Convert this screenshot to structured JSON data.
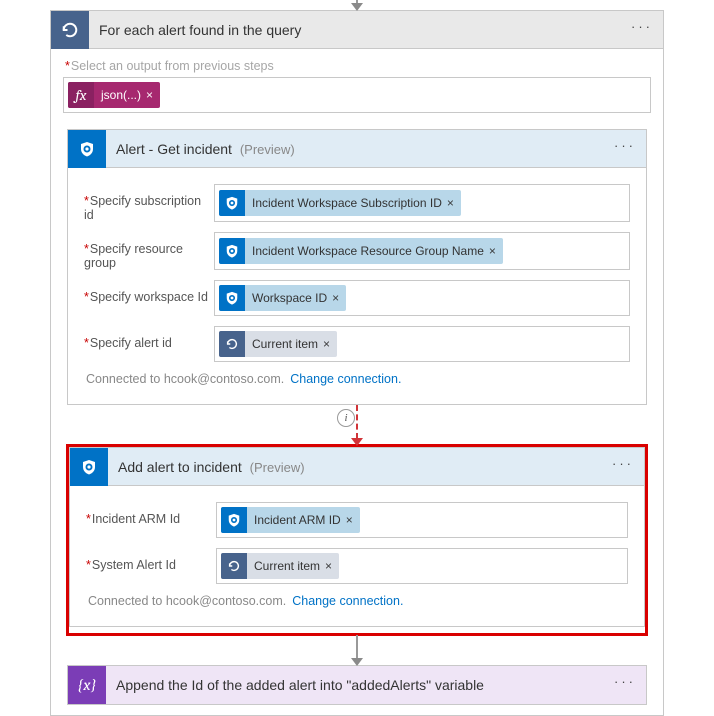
{
  "foreach": {
    "title": "For each alert found in the query",
    "outputLabel": "Select an output from previous steps",
    "jsonToken": "json(...)"
  },
  "getIncident": {
    "title": "Alert - Get incident",
    "preview": "(Preview)",
    "rows": {
      "sub": {
        "label": "Specify subscription id",
        "token": "Incident Workspace Subscription ID"
      },
      "rg": {
        "label": "Specify resource group",
        "token": "Incident Workspace Resource Group Name"
      },
      "ws": {
        "label": "Specify workspace Id",
        "token": "Workspace ID"
      },
      "al": {
        "label": "Specify alert id",
        "token": "Current item"
      }
    }
  },
  "addAlert": {
    "title": "Add alert to incident",
    "preview": "(Preview)",
    "rows": {
      "arm": {
        "label": "Incident ARM Id",
        "token": "Incident ARM ID"
      },
      "sys": {
        "label": "System Alert Id",
        "token": "Current item"
      }
    }
  },
  "connection": {
    "text": "Connected to hcook@contoso.com.",
    "change": "Change connection."
  },
  "appendVar": {
    "title": "Append the Id of the added alert into \"addedAlerts\" variable"
  },
  "close": "×"
}
